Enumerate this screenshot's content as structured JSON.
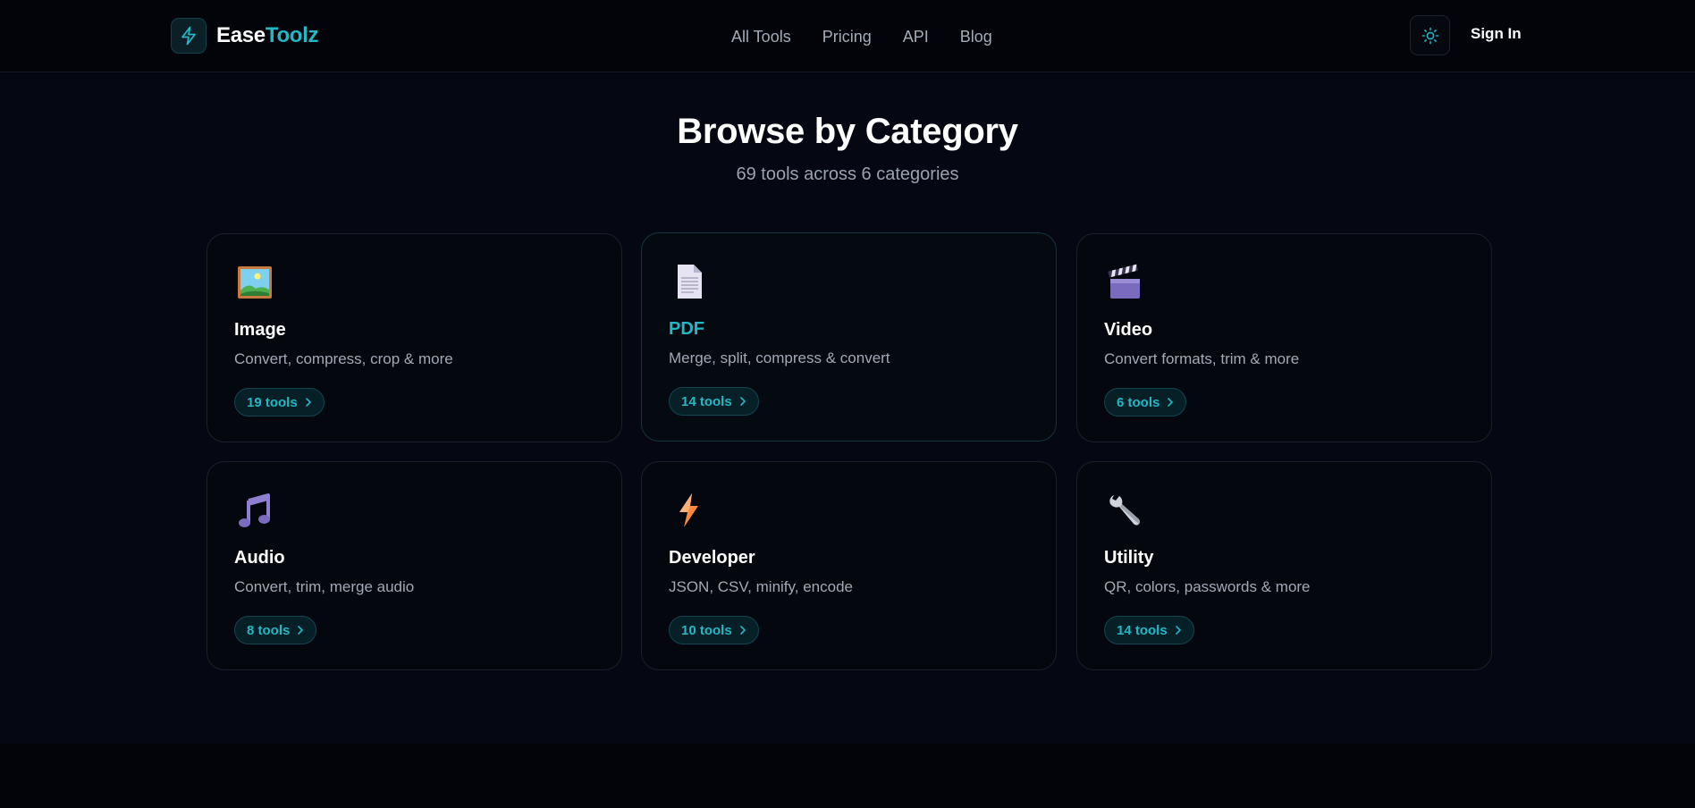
{
  "brand": {
    "name_part1": "Ease",
    "name_part2": "Toolz"
  },
  "nav": {
    "items": [
      {
        "label": "All Tools"
      },
      {
        "label": "Pricing"
      },
      {
        "label": "API"
      },
      {
        "label": "Blog"
      }
    ]
  },
  "header": {
    "theme_toggle_icon": "sun-icon",
    "signin_label": "Sign In"
  },
  "hero": {
    "title": "Browse by Category",
    "subtitle": "69 tools across 6 categories"
  },
  "categories": [
    {
      "title": "Image",
      "description": "Convert, compress, crop & more",
      "count_label": "19 tools",
      "icon": "framed-picture-icon"
    },
    {
      "title": "PDF",
      "description": "Merge, split, compress & convert",
      "count_label": "14 tools",
      "icon": "document-icon"
    },
    {
      "title": "Video",
      "description": "Convert formats, trim & more",
      "count_label": "6 tools",
      "icon": "clapper-board-icon"
    },
    {
      "title": "Audio",
      "description": "Convert, trim, merge audio",
      "count_label": "8 tools",
      "icon": "music-note-icon"
    },
    {
      "title": "Developer",
      "description": "JSON, CSV, minify, encode",
      "count_label": "10 tools",
      "icon": "lightning-icon"
    },
    {
      "title": "Utility",
      "description": "QR, colors, passwords & more",
      "count_label": "14 tools",
      "icon": "wrench-icon"
    }
  ],
  "colors": {
    "accent": "#22b8c6",
    "background": "#050812",
    "card_border": "#1a202b",
    "muted_text": "#a2a9b5"
  }
}
